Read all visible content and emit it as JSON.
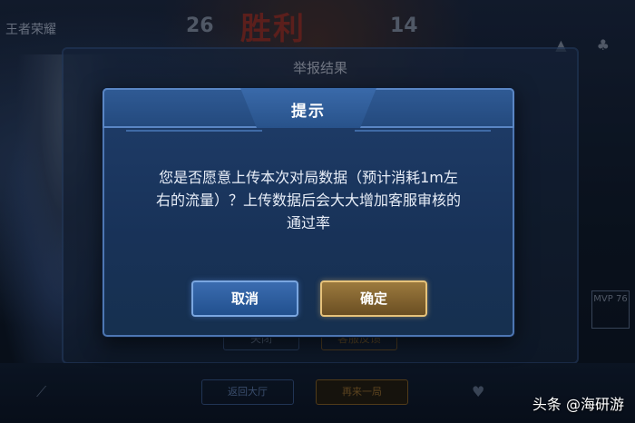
{
  "background": {
    "logo_text": "王者荣耀",
    "top_left_score": "26",
    "top_banner": "胜利",
    "top_right_score": "14",
    "report_panel_title": "举报结果",
    "report_btn_close": "关闭",
    "report_btn_feedback": "客服反馈",
    "side_label": "MVP 76",
    "bottom_btn_left": "返回大厅",
    "bottom_btn_right": "再来一局"
  },
  "dialog": {
    "title": "提示",
    "message_line1": "您是否愿意上传本次对局数据（预计消耗1m左",
    "message_line2": "右的流量）？上传数据后会大大增加客服审核的",
    "message_line3": "通过率",
    "cancel_label": "取消",
    "confirm_label": "确定"
  },
  "watermark": "头条 @海研游",
  "colors": {
    "cancel_button": "#2a5a9c",
    "confirm_button": "#8a6a32",
    "dialog_bg": "#1c3860",
    "title_text": "#ffffff"
  }
}
